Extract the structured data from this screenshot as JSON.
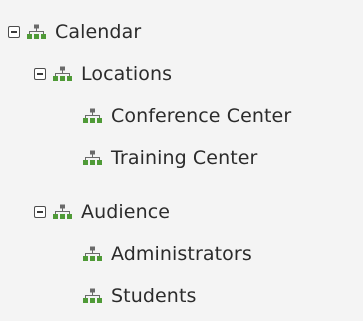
{
  "tree": {
    "root": {
      "label": "Calendar",
      "expanded": true,
      "icon": "hierarchy-icon",
      "children": [
        {
          "label": "Locations",
          "expanded": true,
          "icon": "hierarchy-icon",
          "children": [
            {
              "label": "Conference Center",
              "icon": "hierarchy-icon"
            },
            {
              "label": "Training Center",
              "icon": "hierarchy-icon"
            }
          ]
        },
        {
          "label": "Audience",
          "expanded": true,
          "icon": "hierarchy-icon",
          "children": [
            {
              "label": "Administrators",
              "icon": "hierarchy-icon"
            },
            {
              "label": "Students",
              "icon": "hierarchy-icon"
            }
          ]
        }
      ]
    }
  },
  "colors": {
    "background": "#f4f4f4",
    "text": "#2b2b2b",
    "icon_top": "#6a6a6a",
    "icon_boxes": "#4f9a37"
  }
}
